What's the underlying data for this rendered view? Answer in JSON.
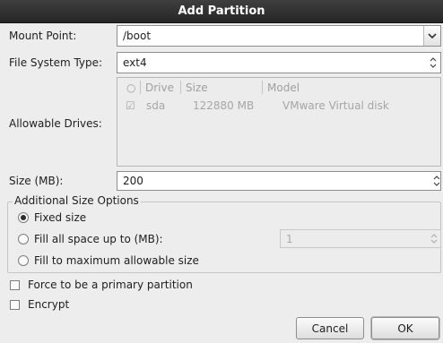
{
  "window": {
    "title": "Add Partition"
  },
  "mount_point": {
    "label": "Mount Point:",
    "value": "/boot"
  },
  "fs_type": {
    "label": "File System Type:",
    "value": "ext4"
  },
  "drives": {
    "label": "Allowable Drives:",
    "columns": [
      "Drive",
      "Size",
      "Model"
    ],
    "rows": [
      {
        "drive": "sda",
        "size": "122880 MB",
        "model": "VMware Virtual disk",
        "checked": true
      }
    ]
  },
  "size": {
    "label": "Size (MB):",
    "value": "200"
  },
  "size_options": {
    "legend": "Additional Size Options",
    "fixed": "Fixed size",
    "fill_upto": "Fill all space up to (MB):",
    "fill_upto_value": "1",
    "fill_max": "Fill to maximum allowable size",
    "selected": "fixed"
  },
  "primary": {
    "label": "Force to be a primary partition",
    "checked": false
  },
  "encrypt": {
    "label": "Encrypt",
    "checked": false
  },
  "buttons": {
    "cancel": "Cancel",
    "ok": "OK"
  }
}
